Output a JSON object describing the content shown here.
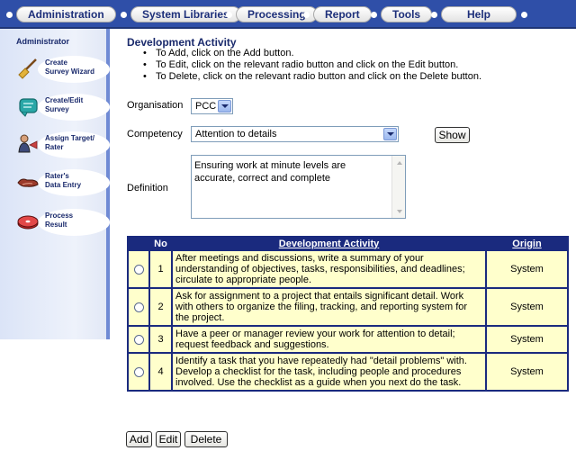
{
  "menu": {
    "tabs": [
      "Administration",
      "System Libraries",
      "Processing",
      "Report",
      "Tools",
      "Help"
    ]
  },
  "sidebar": {
    "title": "Administrator",
    "items": [
      {
        "label": "Create\nSurvey Wizard",
        "icon": "broom-icon"
      },
      {
        "label": "Create/Edit\nSurvey",
        "icon": "clipboard-icon"
      },
      {
        "label": "Assign Target/\nRater",
        "icon": "person-icon"
      },
      {
        "label": "Rater's\nData Entry",
        "icon": "hands-icon"
      },
      {
        "label": "Process\nResult",
        "icon": "cd-icon"
      }
    ]
  },
  "page": {
    "title": "Development Activity",
    "instructions": [
      "To Add, click on the Add button.",
      "To Edit, click on the relevant radio button and click on the Edit button.",
      "To Delete, click on the relevant radio button and click on the Delete button."
    ]
  },
  "form": {
    "organisation_label": "Organisation",
    "organisation_value": "PCC",
    "competency_label": "Competency",
    "competency_value": "Attention to details",
    "show_button": "Show",
    "definition_label": "Definition",
    "definition_text": "Ensuring work at minute levels are accurate, correct and complete"
  },
  "table": {
    "headers": {
      "no": "No",
      "activity": "Development Activity",
      "origin": "Origin"
    },
    "rows": [
      {
        "no": "1",
        "activity": "After meetings and discussions, write a summary of your understanding of objectives, tasks, responsibilities, and deadlines; circulate to appropriate people.",
        "origin": "System"
      },
      {
        "no": "2",
        "activity": "Ask for assignment to a project that entails significant detail. Work with others to organize the filing, tracking, and reporting system for the project.",
        "origin": "System"
      },
      {
        "no": "3",
        "activity": "Have a peer or manager review your work for attention to detail; request feedback and suggestions.",
        "origin": "System"
      },
      {
        "no": "4",
        "activity": "Identify a task that you have repeatedly had \"detail problems\" with. Develop a checklist for the task, including people and procedures involved. Use the checklist as a guide when you next do the task.",
        "origin": "System"
      }
    ]
  },
  "actions": {
    "add": "Add",
    "edit": "Edit",
    "delete": "Delete"
  },
  "colors": {
    "menu_bg": "#2f4fa8",
    "accent_text": "#1a2a6c",
    "table_header": "#1a2a7e",
    "table_cell": "#ffffcc"
  }
}
